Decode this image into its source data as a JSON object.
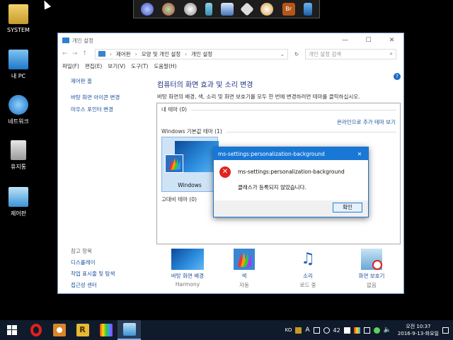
{
  "desktop": {
    "icons": [
      {
        "label": "SYSTEM"
      },
      {
        "label": "내 PC"
      },
      {
        "label": "네트워크"
      },
      {
        "label": "휴지통"
      },
      {
        "label": "제어판"
      }
    ]
  },
  "window": {
    "title": "개인 설정",
    "breadcrumb": [
      "제어판",
      "모양 및 개인 설정",
      "개인 설정"
    ],
    "search_placeholder": "개인 설정 검색",
    "menu": [
      "파일(F)",
      "편집(E)",
      "보기(V)",
      "도구(T)",
      "도움말(H)"
    ],
    "left_nav": {
      "home": "제어판 홈",
      "items": [
        "바탕 화면 아이콘 변경",
        "마우스 포인터 변경"
      ]
    },
    "related": {
      "header": "참고 항목",
      "items": [
        "디스플레이",
        "작업 표시줄 및 탐색",
        "접근성 센터"
      ]
    },
    "heading": "컴퓨터의 화면 효과 및 소리 변경",
    "subheading": "바탕 화면의 배경, 색, 소리 및 화면 보호기를 모두 한 번에 변경하려면 테마를 클릭하십시오.",
    "themes": {
      "my_themes": "내 테마 (0)",
      "online_link": "온라인으로 추가 테마 보기",
      "default_header": "Windows 기본값 테마 (1)",
      "default_theme_name": "Windows",
      "high_contrast": "고대비 테마 (0)"
    },
    "bottom_items": [
      {
        "label": "바탕 화면 배경",
        "value": "Harmony"
      },
      {
        "label": "색",
        "value": "자동"
      },
      {
        "label": "소리",
        "value": "로드 중"
      },
      {
        "label": "화면 보호기",
        "value": "없음"
      }
    ]
  },
  "dialog": {
    "title": "ms-settings:personalization-background",
    "message": "ms-settings:personalization-background",
    "detail": "클래스가 등록되지 않았습니다.",
    "ok": "확인"
  },
  "taskbar": {
    "tray": {
      "ime": "KO",
      "ime_mode": "A",
      "count": "42"
    },
    "clock": {
      "time": "오전 10:37",
      "date": "2016-9-13-화요일"
    }
  },
  "colors": {
    "titlebar_dialog": "#1978d6",
    "link": "#1a4f9c",
    "heading": "#1e3287",
    "taskbar": "#0f1a2b",
    "error": "#e0241e"
  }
}
